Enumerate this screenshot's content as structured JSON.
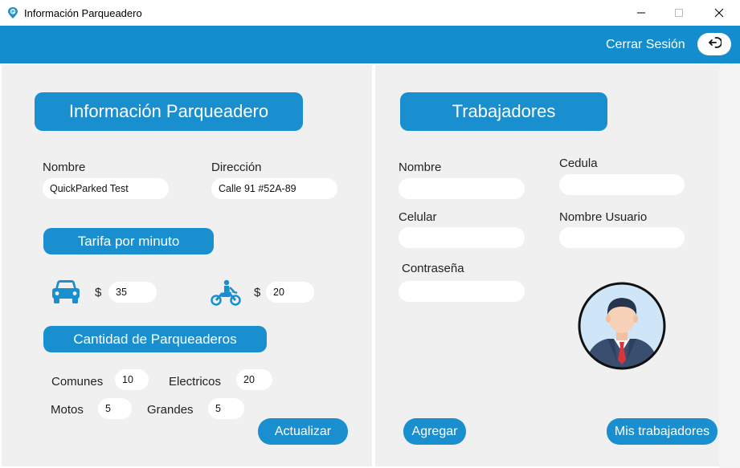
{
  "window": {
    "title": "Información Parqueadero"
  },
  "header": {
    "logout_label": "Cerrar Sesión"
  },
  "parking": {
    "title": "Información Parqueadero",
    "name_label": "Nombre",
    "name_value": "QuickParked Test",
    "address_label": "Dirección",
    "address_value": "Calle 91 #52A-89",
    "rate_title": "Tarifa por minuto",
    "currency_symbol": "$",
    "car_rate": "35",
    "moto_rate": "20",
    "quantity_title": "Cantidad de Parqueaderos",
    "common_label": "Comunes",
    "common_value": "10",
    "electric_label": "Electricos",
    "electric_value": "20",
    "motos_label": "Motos",
    "motos_value": "5",
    "large_label": "Grandes",
    "large_value": "5",
    "update_button": "Actualizar"
  },
  "workers": {
    "title": "Trabajadores",
    "name_label": "Nombre",
    "name_value": "",
    "id_label": "Cedula",
    "id_value": "",
    "phone_label": "Celular",
    "phone_value": "",
    "username_label": "Nombre Usuario",
    "username_value": "",
    "password_label": "Contraseña",
    "password_value": "",
    "add_button": "Agregar",
    "my_workers_button": "Mis trabajadores"
  },
  "icons": {
    "app": "parking-pin-icon",
    "logout": "logout-icon",
    "car": "car-icon",
    "motorcycle": "motorcycle-icon",
    "avatar": "worker-avatar-icon"
  },
  "colors": {
    "accent": "#138dce",
    "button": "#1a8fd0",
    "panel": "#f0f0f0",
    "icon": "#1a8fd0"
  }
}
